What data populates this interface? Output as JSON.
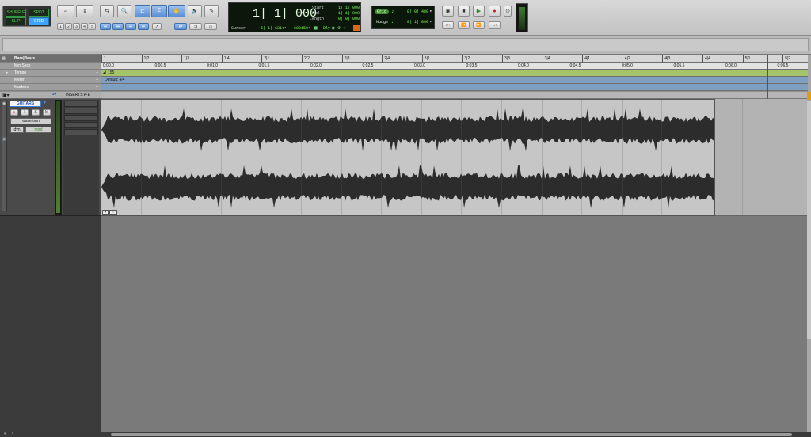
{
  "edit_modes": {
    "shuffle": "SHUFFLE",
    "spot": "SPOT",
    "slip": "SLIP",
    "grid": "GRID"
  },
  "zoom_presets": [
    "1",
    "2",
    "3",
    "4",
    "5"
  ],
  "counter": {
    "main": "1| 1| 000",
    "start_label": "Start",
    "end_label": "End",
    "length_label": "Length",
    "start": "1| 1| 000",
    "end": "1| 1| 000",
    "length": "0| 0| 000",
    "cursor_label": "Cursor",
    "cursor_value": "5| 1| 631",
    "sample_value": "6801504",
    "dly_label": "Dly"
  },
  "grid_nudge": {
    "grid_label": "Grid",
    "grid_value": "0| 0| 480",
    "nudge_label": "Nudge",
    "nudge_value": "0| 1| 000"
  },
  "rulers": [
    {
      "name": "Bars|Beats",
      "key": "bars"
    },
    {
      "name": "Min:Secs",
      "key": "mins"
    },
    {
      "name": "Tempo",
      "key": "tempo"
    },
    {
      "name": "Meter",
      "key": "meter"
    },
    {
      "name": "Markers",
      "key": "markers"
    }
  ],
  "bars_ticks": [
    "1",
    "1|2",
    "1|3",
    "1|4",
    "2|1",
    "2|2",
    "2|3",
    "2|4",
    "3|1",
    "3|2",
    "3|3",
    "3|4",
    "4|1",
    "4|2",
    "4|3",
    "4|4",
    "5|1",
    "5|2"
  ],
  "mins_ticks": [
    "0:00.0",
    "0:00.5",
    "0:01.0",
    "0:01.5",
    "0:02.0",
    "0:02.5",
    "0:03.0",
    "0:03.5",
    "0:04.0",
    "0:04.5",
    "0:05.0",
    "0:05.5",
    "0:06.0",
    "0:06.5"
  ],
  "tempo_value": "155",
  "meter_value": "Default: 4/4",
  "track_column_header": "INSERTS A-E",
  "track": {
    "name": "GUITARS",
    "view": "waveform",
    "dyn": "dyn",
    "mode": "read",
    "rec": "●",
    "solo": "S",
    "mute": "M"
  },
  "colors": {
    "lcd_green": "#7dff52",
    "tempo_bar": "#a5c36b",
    "meter_bar": "#7f9fc2",
    "waveform": "#2c2c2c",
    "playhead": "#d02020"
  }
}
